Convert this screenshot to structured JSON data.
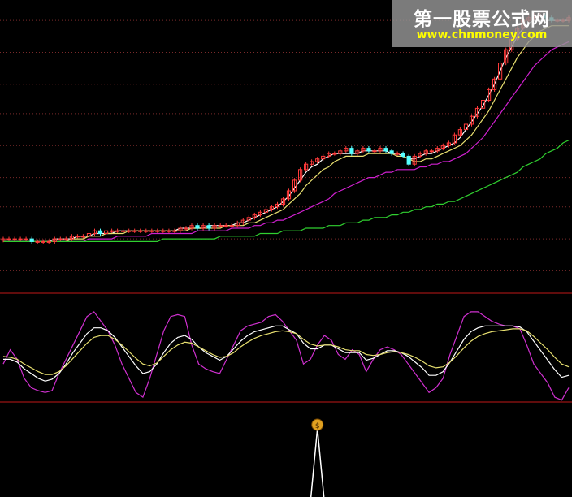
{
  "watermark": {
    "title": "第一股票公式网",
    "url": "www.chnmoney.com"
  },
  "colors": {
    "background": "#000000",
    "grid": "#7a2a2a",
    "panel_divider": "#c01818",
    "candle_up": "#ff3a3a",
    "candle_down": "#55ffff",
    "ma_white": "#ffffff",
    "ma_yellow": "#e8e070",
    "ma_magenta": "#d020d0",
    "ma_green": "#30d030",
    "osc_magenta": "#d030d0",
    "osc_white": "#ffffff",
    "osc_yellow": "#e8e070",
    "signal": "#ffffff",
    "money_bag": "#e0a020"
  },
  "chart_data": [
    {
      "type": "candlestick",
      "panel": "price",
      "x_count": 100,
      "y_range": [
        0,
        100
      ],
      "grid_levels": [
        2,
        14,
        26,
        37,
        49,
        61,
        72,
        84,
        96
      ],
      "close": [
        14,
        14,
        14,
        14,
        14,
        13,
        13,
        13,
        13,
        14,
        14,
        14,
        15,
        15,
        15,
        16,
        17,
        16,
        17,
        17,
        17,
        17,
        17,
        17,
        17,
        17,
        17,
        17,
        17,
        17,
        17,
        18,
        18,
        19,
        18,
        19,
        18,
        19,
        19,
        19,
        19,
        20,
        21,
        22,
        23,
        24,
        25,
        26,
        27,
        29,
        32,
        36,
        40,
        42,
        43,
        44,
        45,
        46,
        46,
        47,
        48,
        46,
        47,
        48,
        47,
        47,
        48,
        47,
        46,
        46,
        45,
        42,
        45,
        46,
        47,
        47,
        48,
        49,
        50,
        53,
        55,
        57,
        60,
        63,
        66,
        70,
        74,
        80,
        85,
        89,
        93,
        96,
        97,
        98,
        98,
        97,
        96,
        96,
        96,
        97
      ],
      "moving_averages": [
        {
          "color_key": "ma_white",
          "values": [
            13,
            13,
            13,
            13,
            13,
            13,
            13,
            13,
            13,
            14,
            14,
            14,
            14,
            15,
            15,
            15,
            16,
            16,
            16,
            16,
            17,
            17,
            17,
            17,
            17,
            17,
            17,
            17,
            17,
            17,
            17,
            18,
            18,
            18,
            18,
            18,
            19,
            19,
            19,
            19,
            19,
            20,
            20,
            21,
            22,
            23,
            24,
            25,
            26,
            28,
            30,
            33,
            36,
            39,
            41,
            42,
            44,
            45,
            46,
            46,
            46,
            46,
            46,
            47,
            47,
            47,
            47,
            47,
            46,
            46,
            45,
            44,
            44,
            45,
            46,
            46,
            47,
            48,
            49,
            50,
            52,
            55,
            58,
            61,
            64,
            68,
            72,
            77,
            82,
            86,
            90,
            93,
            95,
            96,
            96,
            96,
            96,
            96,
            96,
            96
          ]
        },
        {
          "color_key": "ma_yellow",
          "values": [
            13,
            13,
            13,
            13,
            13,
            13,
            13,
            13,
            13,
            13,
            13,
            13,
            14,
            14,
            14,
            15,
            15,
            15,
            16,
            16,
            16,
            16,
            17,
            17,
            17,
            17,
            17,
            17,
            17,
            17,
            17,
            17,
            17,
            18,
            18,
            18,
            18,
            18,
            18,
            19,
            19,
            19,
            19,
            20,
            20,
            21,
            22,
            23,
            24,
            25,
            27,
            29,
            31,
            34,
            36,
            38,
            40,
            41,
            43,
            44,
            45,
            45,
            45,
            45,
            46,
            46,
            46,
            46,
            46,
            45,
            45,
            44,
            43,
            43,
            44,
            44,
            45,
            46,
            47,
            48,
            49,
            51,
            53,
            56,
            59,
            62,
            66,
            70,
            74,
            78,
            82,
            85,
            88,
            90,
            92,
            93,
            94,
            94,
            94,
            94
          ]
        },
        {
          "color_key": "ma_magenta",
          "values": [
            13,
            13,
            13,
            13,
            13,
            13,
            13,
            13,
            13,
            13,
            13,
            13,
            13,
            13,
            13,
            14,
            14,
            14,
            14,
            14,
            15,
            15,
            15,
            15,
            15,
            15,
            16,
            16,
            16,
            16,
            16,
            16,
            16,
            16,
            17,
            17,
            17,
            17,
            17,
            17,
            18,
            18,
            18,
            18,
            19,
            19,
            20,
            20,
            21,
            21,
            22,
            23,
            24,
            25,
            26,
            27,
            28,
            29,
            31,
            32,
            33,
            34,
            35,
            36,
            37,
            37,
            38,
            39,
            39,
            40,
            40,
            40,
            40,
            41,
            41,
            42,
            42,
            43,
            43,
            44,
            45,
            46,
            48,
            50,
            52,
            55,
            58,
            61,
            64,
            67,
            70,
            73,
            76,
            79,
            81,
            83,
            85,
            86,
            87,
            88
          ]
        },
        {
          "color_key": "ma_green",
          "values": [
            13,
            13,
            13,
            13,
            13,
            13,
            13,
            13,
            13,
            13,
            13,
            13,
            13,
            13,
            13,
            13,
            13,
            13,
            13,
            13,
            13,
            13,
            13,
            13,
            13,
            13,
            13,
            13,
            14,
            14,
            14,
            14,
            14,
            14,
            14,
            14,
            14,
            14,
            15,
            15,
            15,
            15,
            15,
            15,
            15,
            16,
            16,
            16,
            16,
            17,
            17,
            17,
            17,
            18,
            18,
            18,
            18,
            19,
            19,
            19,
            20,
            20,
            20,
            21,
            21,
            22,
            22,
            22,
            23,
            23,
            24,
            24,
            25,
            25,
            26,
            26,
            27,
            27,
            28,
            28,
            29,
            30,
            31,
            32,
            33,
            34,
            35,
            36,
            37,
            38,
            39,
            41,
            42,
            43,
            44,
            46,
            47,
            48,
            50,
            51
          ]
        }
      ]
    },
    {
      "type": "line",
      "panel": "oscillator",
      "x_count": 100,
      "y_range": [
        0,
        100
      ],
      "series": [
        {
          "color_key": "osc_magenta",
          "values": [
            40,
            55,
            45,
            25,
            15,
            12,
            10,
            12,
            30,
            45,
            60,
            75,
            90,
            95,
            85,
            75,
            60,
            40,
            25,
            10,
            5,
            25,
            50,
            75,
            90,
            92,
            90,
            60,
            40,
            35,
            32,
            30,
            45,
            60,
            75,
            80,
            82,
            84,
            90,
            92,
            85,
            75,
            65,
            40,
            45,
            60,
            70,
            65,
            50,
            45,
            55,
            50,
            32,
            45,
            55,
            58,
            55,
            50,
            40,
            30,
            20,
            10,
            15,
            25,
            50,
            70,
            90,
            95,
            95,
            90,
            85,
            82,
            80,
            80,
            77,
            60,
            40,
            30,
            20,
            5,
            2,
            15
          ]
        },
        {
          "color_key": "osc_white",
          "values": [
            45,
            45,
            42,
            35,
            30,
            25,
            22,
            24,
            30,
            40,
            52,
            62,
            72,
            78,
            78,
            75,
            68,
            58,
            48,
            38,
            30,
            32,
            40,
            52,
            62,
            68,
            70,
            66,
            58,
            52,
            48,
            44,
            48,
            56,
            64,
            70,
            74,
            76,
            78,
            80,
            80,
            76,
            72,
            62,
            56,
            56,
            60,
            60,
            56,
            52,
            52,
            52,
            44,
            46,
            50,
            54,
            54,
            52,
            48,
            42,
            36,
            28,
            28,
            32,
            42,
            54,
            66,
            74,
            78,
            80,
            80,
            80,
            80,
            80,
            79,
            74,
            64,
            54,
            44,
            34,
            26,
            28
          ]
        },
        {
          "color_key": "osc_yellow",
          "values": [
            48,
            47,
            45,
            40,
            36,
            32,
            29,
            29,
            32,
            38,
            46,
            54,
            62,
            68,
            70,
            70,
            66,
            60,
            53,
            46,
            40,
            38,
            41,
            48,
            55,
            60,
            63,
            62,
            58,
            54,
            50,
            47,
            48,
            52,
            58,
            63,
            67,
            70,
            72,
            74,
            75,
            74,
            72,
            66,
            61,
            59,
            60,
            60,
            58,
            55,
            54,
            54,
            50,
            49,
            50,
            52,
            53,
            52,
            50,
            47,
            43,
            38,
            36,
            37,
            42,
            49,
            57,
            64,
            69,
            72,
            74,
            75,
            76,
            77,
            77,
            75,
            69,
            62,
            55,
            47,
            40,
            37
          ]
        }
      ]
    },
    {
      "type": "signal",
      "panel": "signal",
      "x_count": 100,
      "spikes": [
        {
          "x": 55,
          "value": 100
        }
      ]
    }
  ]
}
